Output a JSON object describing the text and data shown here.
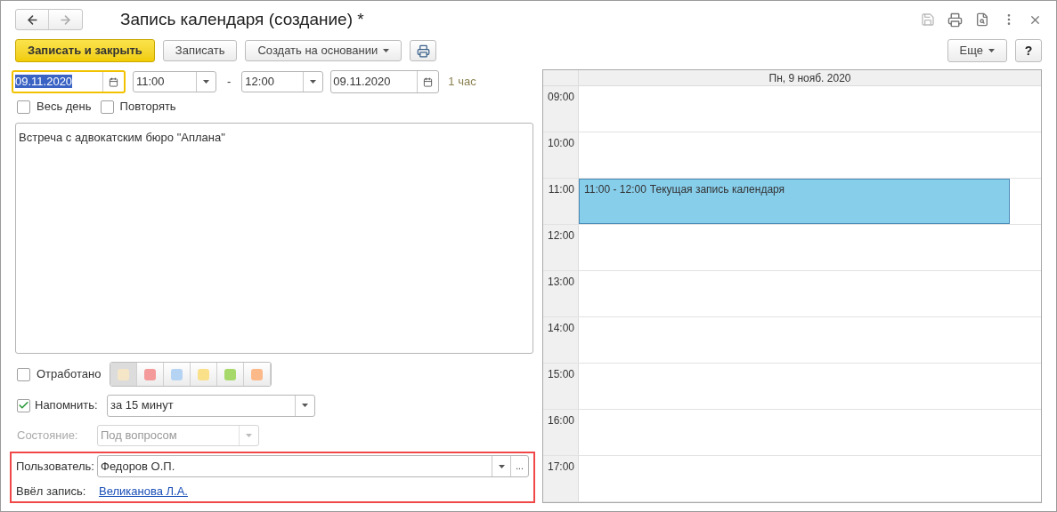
{
  "window": {
    "title": "Запись календаря (создание) *"
  },
  "toolbar": [
    {
      "kind": "primary",
      "label": "Записать и закрыть"
    },
    {
      "kind": "plain",
      "label": "Записать"
    },
    {
      "kind": "dropdown",
      "label": "Создать на основании"
    },
    {
      "kind": "print"
    }
  ],
  "toolbar_right": [
    {
      "kind": "dropdown",
      "label": "Еще"
    },
    {
      "kind": "plain",
      "label": "?"
    }
  ],
  "period": {
    "start_date": {
      "value": "09.11.2020",
      "focused": true
    },
    "start_time": "11:00",
    "separator": "-",
    "end_time": "12:00",
    "end_date": {
      "value": "09.11.2020",
      "focused": false
    },
    "duration": "1 час"
  },
  "options": [
    {
      "label": "Весь день",
      "checked": false
    },
    {
      "label": "Повторять",
      "checked": false
    }
  ],
  "description": "Встреча с адвокатским бюро \"Аплана\"",
  "done": {
    "label": "Отработано",
    "checked": false
  },
  "colors": [
    {
      "color": "#f5e6c8",
      "selected": true
    },
    {
      "color": "#f49a9a",
      "selected": false
    },
    {
      "color": "#b5d3f3",
      "selected": false
    },
    {
      "color": "#fbe08a",
      "selected": false
    },
    {
      "color": "#a6d96a",
      "selected": false
    },
    {
      "color": "#fbb98a",
      "selected": false
    }
  ],
  "remind": {
    "label": "Напомнить:",
    "checked": true,
    "value": "за 15 минут"
  },
  "state": {
    "label": "Состояние:",
    "value": "Под вопросом",
    "disabled": true
  },
  "user": {
    "label": "Пользователь:",
    "value": "Федоров О.П.",
    "more": "..."
  },
  "author": {
    "label": "Ввёл запись:",
    "value": "Великанова Л.А."
  },
  "calendar": {
    "header": "Пн, 9 нояб. 2020",
    "hours": [
      {
        "label": "09:00"
      },
      {
        "label": "10:00"
      },
      {
        "label": "11:00",
        "event": {
          "time": "11:00 - 12:00",
          "title": "Текущая запись календаря"
        }
      },
      {
        "label": "12:00"
      },
      {
        "label": "13:00"
      },
      {
        "label": "14:00"
      },
      {
        "label": "15:00"
      },
      {
        "label": "16:00"
      },
      {
        "label": "17:00"
      }
    ]
  }
}
